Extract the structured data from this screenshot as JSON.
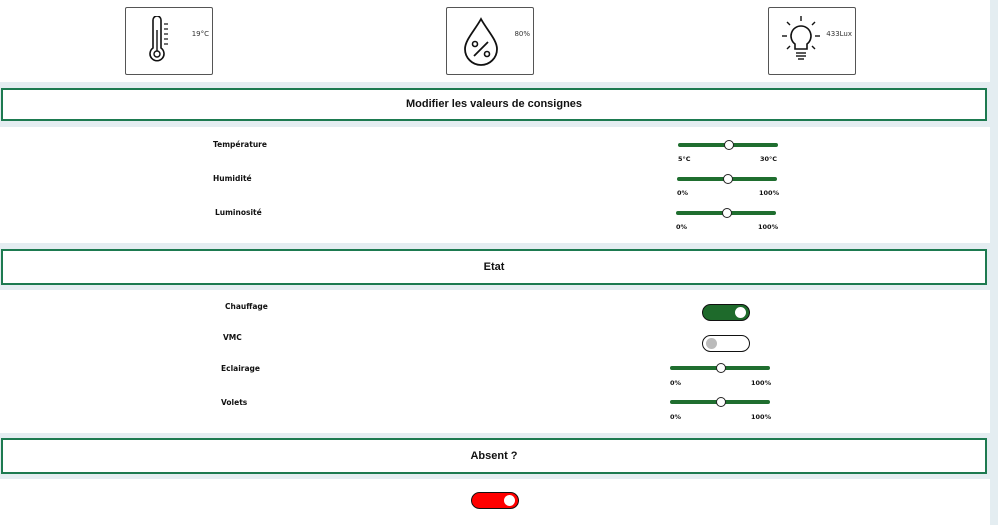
{
  "sensors": {
    "temperature": {
      "icon": "thermometer-icon",
      "value": "19°C"
    },
    "humidity": {
      "icon": "humidity-drop-icon",
      "value": "80%"
    },
    "light": {
      "icon": "light-bulb-icon",
      "value": "433Lux"
    }
  },
  "setpoints": {
    "title": "Modifier les valeurs de consignes",
    "rows": [
      {
        "label": "Température",
        "min": "5°C",
        "max": "30°C",
        "value": 0.5
      },
      {
        "label": "Humidité",
        "min": "0%",
        "max": "100%",
        "value": 0.5
      },
      {
        "label": "Luminosité",
        "min": "0%",
        "max": "100%",
        "value": 0.5
      }
    ]
  },
  "state": {
    "title": "Etat",
    "heating": {
      "label": "Chauffage",
      "on": true
    },
    "vmc": {
      "label": "VMC",
      "on": false
    },
    "lighting": {
      "label": "Eclairage",
      "min": "0%",
      "max": "100%",
      "value": 0.5
    },
    "shutters": {
      "label": "Volets",
      "min": "0%",
      "max": "100%",
      "value": 0.5
    }
  },
  "absent": {
    "title": "Absent ?",
    "on": true
  },
  "colors": {
    "accent_border": "#1d7a50",
    "slider_green": "#1f6e2f",
    "toggle_on": "#1e6a2b",
    "absent_toggle": "#ff0000"
  }
}
